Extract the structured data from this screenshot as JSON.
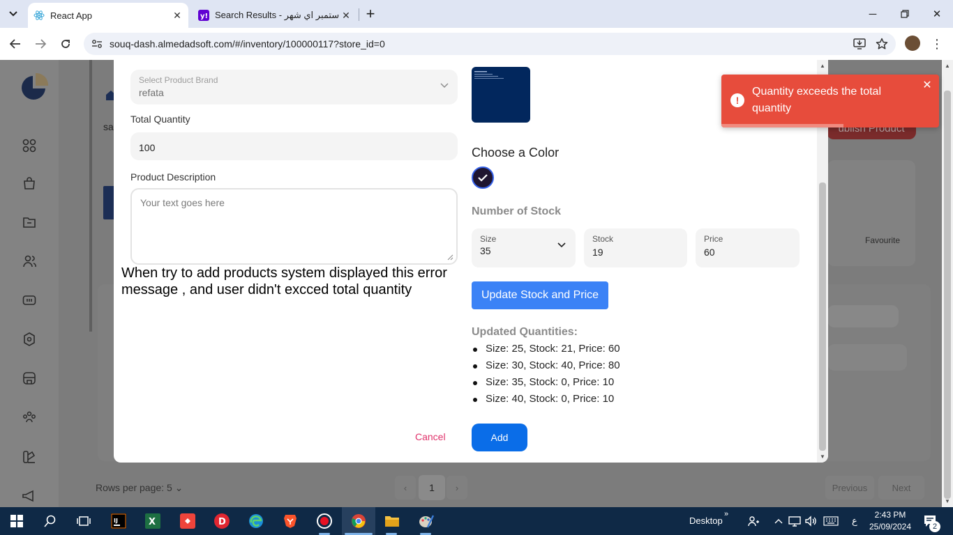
{
  "browser": {
    "tabs": [
      {
        "title": "React App",
        "active": true
      },
      {
        "title": "Search Results - ستمبر اي شهر",
        "active": false
      }
    ],
    "url": "souq-dash.almedadsoft.com/#/inventory/100000117?store_id=0"
  },
  "background": {
    "publish_label": "ublish Product",
    "favourite_label": "Favourite",
    "rows_per_page": "Rows per page: 5",
    "current_page": "1",
    "previous_label": "Previous",
    "next_label": "Next",
    "header_fragment": "sa"
  },
  "modal": {
    "brand": {
      "label": "Select Product Brand",
      "value": "refata"
    },
    "total_quantity": {
      "label": "Total Quantity",
      "value": "100"
    },
    "description": {
      "label": "Product Description",
      "placeholder": "Your text goes here"
    },
    "annotation": "When try to add products  system displayed this error message , and user didn't excced total quantity",
    "choose_color_title": "Choose a Color",
    "selected_color": "#1f1530",
    "stock_title": "Number of Stock",
    "size": {
      "label": "Size",
      "value": "35"
    },
    "stock": {
      "label": "Stock",
      "value": "19"
    },
    "price": {
      "label": "Price",
      "value": "60"
    },
    "update_button": "Update Stock and Price",
    "updated_title": "Updated Quantities:",
    "updated_quantities": [
      "Size: 25, Stock: 21, Price: 60",
      "Size: 30, Stock: 40, Price: 80",
      "Size: 35, Stock: 0, Price: 10",
      "Size: 40, Stock: 0, Price: 10"
    ],
    "cancel_label": "Cancel",
    "add_label": "Add"
  },
  "toast": {
    "message": "Quantity exceeds the total quantity",
    "color": "#e74c3c",
    "progress_remaining": 0.56
  },
  "taskbar": {
    "desktop_label": "Desktop",
    "lang": "ع",
    "time": "2:43 PM",
    "date": "25/09/2024",
    "notification_count": "2"
  },
  "colors": {
    "primary": "#3b82f6",
    "add_button": "#0a6de8",
    "cancel": "#e0336b",
    "taskbar": "#0f2946"
  }
}
